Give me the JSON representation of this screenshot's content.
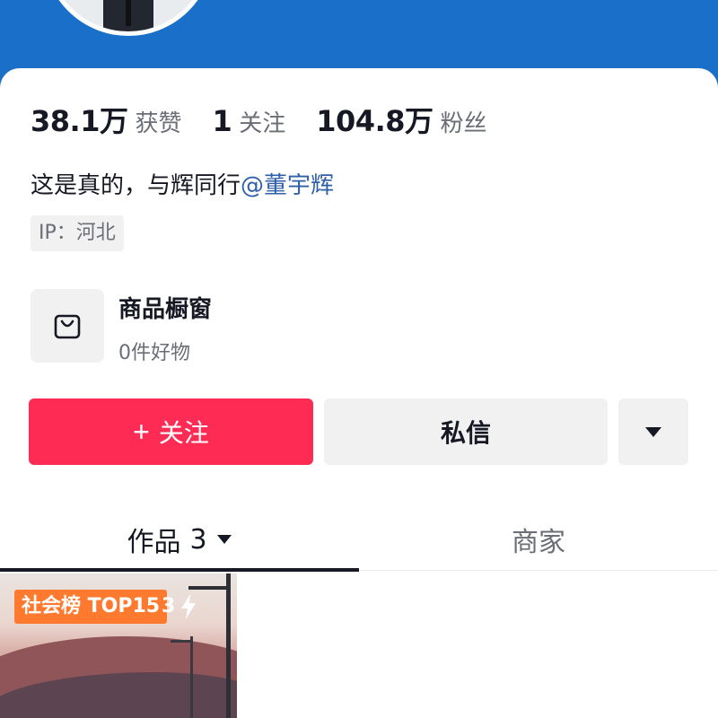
{
  "profile": {
    "stats": [
      {
        "value": "38.1万",
        "label": "获赞"
      },
      {
        "value": "1",
        "label": "关注"
      },
      {
        "value": "104.8万",
        "label": "粉丝"
      }
    ],
    "bio_text": "这是真的，与辉同行",
    "bio_mention": "@董宇辉",
    "ip_label": "IP：河北"
  },
  "shop": {
    "title": "商品橱窗",
    "subtitle": "0件好物",
    "icon": "shopping-bag-icon"
  },
  "actions": {
    "follow_plus": "+",
    "follow_label": "关注",
    "message_label": "私信",
    "more_icon": "triangle-down-icon"
  },
  "tabs": {
    "works_label": "作品",
    "works_count": "3",
    "merchant_label": "商家"
  },
  "video": {
    "rank_badge": "社会榜 TOP15",
    "rank_number": "3"
  },
  "colors": {
    "header": "#1a6fc9",
    "follow_button": "#fe2c55",
    "mention": "#2f5fa8",
    "rank_badge": "#ff7a2f"
  }
}
